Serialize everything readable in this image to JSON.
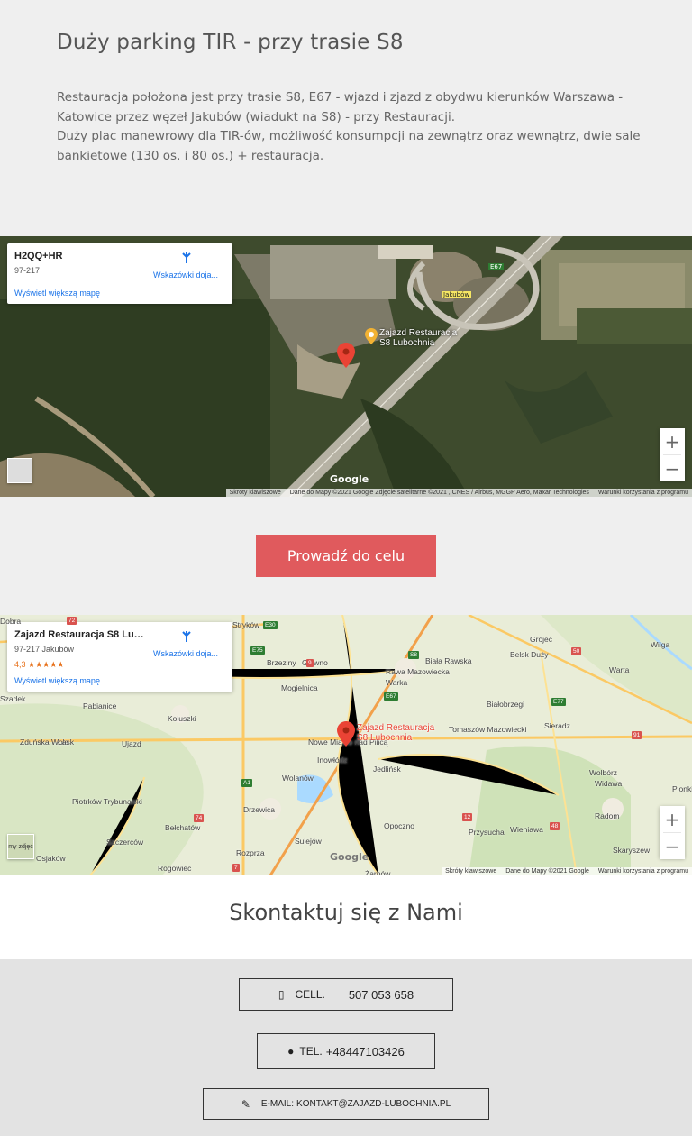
{
  "intro": {
    "title": "Duży parking TIR - przy trasie S8",
    "paragraph1": "Restauracja położona jest przy trasie S8, E67  - wjazd i zjazd z obydwu kierunków Warszawa - Katowice przez węzeł Jakubów (wiadukt na S8) - przy Restauracji.",
    "paragraph2": "Duży plac manewrowy dla TIR-ów, możliwość konsumpcji na zewnątrz oraz wewnątrz, dwie sale bankietowe (130 os. i 80 os.) + restauracja."
  },
  "satellite_map": {
    "card": {
      "title": "H2QQ+HR",
      "address": "97-217",
      "directions_label": "Wskazówki doja...",
      "larger_map_link": "Wyświetl większą mapę"
    },
    "pin_label_line1": "Zajazd Restauracja",
    "pin_label_line2": "S8 Lubochnia",
    "road_labels": [
      "E67",
      "Jakubów"
    ],
    "zoom_in": "+",
    "zoom_out": "−",
    "google_logo": "Google",
    "attribution": {
      "shortcuts": "Skróty klawiszowe",
      "data": "Dane do Mapy ©2021 Google Zdjęcie satelitarne ©2021 , CNES / Airbus, MGGP Aero, Maxar Technologies",
      "terms": "Warunki korzystania z programu"
    }
  },
  "cta": {
    "label": "Prowadź do celu"
  },
  "road_map": {
    "card": {
      "title": "Zajazd Restauracja S8 Luboch...",
      "address": "97-217 Jakubów",
      "rating": "4,3 ★★★★★",
      "directions_label": "Wskazówki doja...",
      "larger_map_link": "Wyświetl większą mapę"
    },
    "pin_label_line1": "Zajazd Restauracja",
    "pin_label_line2": "S8 Lubochnia",
    "places": [
      "Dobra",
      "Stryków",
      "Brzeziny",
      "Głowno",
      "Grójec",
      "Belsk Duży",
      "Wilga",
      "Biała Rawska",
      "Rawa Mazowiecka",
      "Warka",
      "Warta",
      "Szadek",
      "Pabianice",
      "Koluszki",
      "Mogielnica",
      "Białobrzegi",
      "Sieradz",
      "Zduńska Wola",
      "Łask",
      "Ujazd",
      "Nowe Miasto nad Pilicą",
      "Tomaszów Mazowiecki",
      "Inowłódz",
      "Jedlińsk",
      "Wolbórz",
      "Wolanów",
      "Widawa",
      "Piotrków Trybunalski",
      "Drzewica",
      "Pionki",
      "Bełchatów",
      "Sulejów",
      "Opoczno",
      "Przysucha",
      "Wieniawa",
      "Radom",
      "Szczerców",
      "Rozprza",
      "Skaryszew",
      "Osjaków",
      "Rogowiec",
      "Żarnów"
    ],
    "road_labels": [
      "72",
      "E30",
      "E75",
      "S8",
      "E67",
      "50",
      "E77",
      "A1",
      "74",
      "12",
      "48",
      "91",
      "7",
      "9"
    ],
    "thumb_label": "my zdjęć",
    "zoom_in": "+",
    "zoom_out": "−",
    "google_logo": "Google",
    "attribution": {
      "shortcuts": "Skróty klawiszowe",
      "data": "Dane do Mapy ©2021 Google",
      "terms": "Warunki korzystania z programu"
    }
  },
  "contact": {
    "heading": "Skontaktuj się z Nami",
    "cell_label": "CELL.",
    "cell_value": "507 053 658",
    "tel_label": "TEL.",
    "tel_value": "+48447103426",
    "email_label": "E-MAIL:",
    "email_value": "KONTAKT@ZAJAZD-LUBOCHNIA.PL",
    "icons": [
      "mobile-phone-icon",
      "person-icon",
      "pencil-icon"
    ]
  },
  "colors": {
    "background": "#efefef",
    "cta": "#e05a5d",
    "contact_band": "#e3e3e3",
    "pin": "#ea4335",
    "link": "#1a73e8"
  }
}
